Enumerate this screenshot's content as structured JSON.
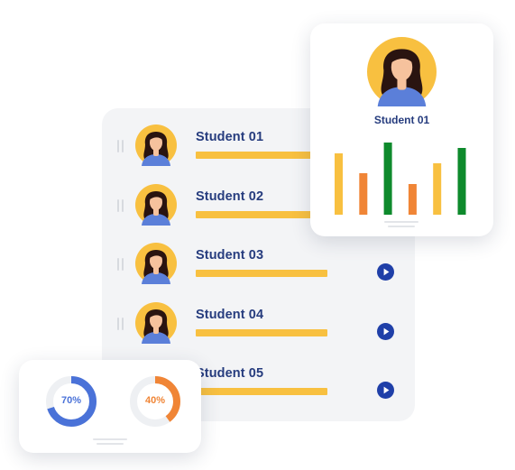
{
  "students": [
    {
      "name": "Student 01"
    },
    {
      "name": "Student 02"
    },
    {
      "name": "Student 03"
    },
    {
      "name": "Student 04"
    },
    {
      "name": "Student 05"
    }
  ],
  "profile_card": {
    "name": "Student 01",
    "chart_data": {
      "type": "bar",
      "values": [
        68,
        46,
        80,
        34,
        57,
        74
      ],
      "colors": [
        "#f8c040",
        "#f08536",
        "#0e8a2c",
        "#f08536",
        "#f8c040",
        "#0e8a2c"
      ]
    }
  },
  "progress": [
    {
      "label": "70%",
      "value": 70,
      "color": "#4a72d8"
    },
    {
      "label": "40%",
      "value": 40,
      "color": "#f08536"
    }
  ],
  "colors": {
    "accent_yellow": "#f8c040",
    "name_navy": "#263c7e",
    "play_blue": "#1f3fa8",
    "avatar_shirt": "#5b7fd9",
    "avatar_hair": "#2a1410",
    "avatar_skin": "#f6c29d"
  },
  "icons": {
    "row_play": "play-icon",
    "row_grip": "drag-handle-icon"
  }
}
